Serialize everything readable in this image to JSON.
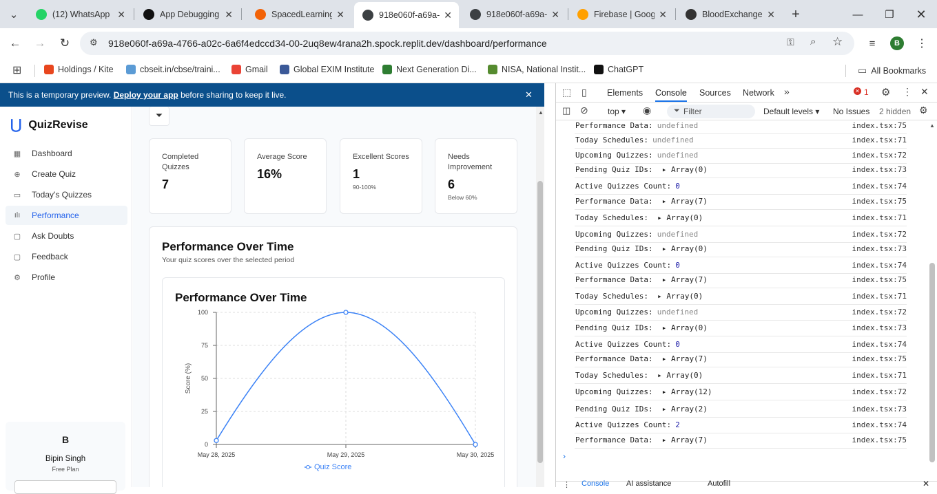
{
  "browser": {
    "tabs": [
      {
        "title": "(12) WhatsApp",
        "color": "#25d366"
      },
      {
        "title": "App Debugging",
        "color": "#111111"
      },
      {
        "title": "SpacedLearning",
        "color": "#f26207"
      },
      {
        "title": "918e060f-a69a-",
        "color": "#3c4043"
      },
      {
        "title": "918e060f-a69a-",
        "color": "#3c4043"
      },
      {
        "title": "Firebase | Googl",
        "color": "#ffa000"
      },
      {
        "title": "BloodExchanger",
        "color": "#333333"
      }
    ],
    "url": "918e060f-a69a-4766-a02c-6a6f4edccd34-00-2uq8ew4rana2h.spock.replit.dev/dashboard/performance",
    "profile_initial": "B",
    "bookmarks": [
      {
        "label": "Holdings / Kite",
        "color": "#e8461e"
      },
      {
        "label": "cbseit.in/cbse/traini...",
        "color": "#5b9bd5"
      },
      {
        "label": "Gmail",
        "color": "#ea4335"
      },
      {
        "label": "Global EXIM Institute",
        "color": "#3b5998"
      },
      {
        "label": "Next Generation Di...",
        "color": "#2e7d32"
      },
      {
        "label": "NISA, National Instit...",
        "color": "#558b2f"
      },
      {
        "label": "ChatGPT",
        "color": "#111111"
      }
    ],
    "all_bookmarks": "All Bookmarks"
  },
  "banner": {
    "prefix": "This is a temporary preview. ",
    "link": "Deploy your app",
    "suffix": " before sharing to keep it live."
  },
  "app": {
    "name": "QuizRevise",
    "nav": [
      {
        "label": "Dashboard",
        "icon": "▦"
      },
      {
        "label": "Create Quiz",
        "icon": "⊕"
      },
      {
        "label": "Today's Quizzes",
        "icon": "▭"
      },
      {
        "label": "Performance",
        "icon": "ılı"
      },
      {
        "label": "Ask Doubts",
        "icon": "▢"
      },
      {
        "label": "Feedback",
        "icon": "▢"
      },
      {
        "label": "Profile",
        "icon": "⚙"
      }
    ],
    "user": {
      "initial": "B",
      "name": "Bipin Singh",
      "plan": "Free Plan"
    }
  },
  "stats": [
    {
      "label": "Completed Quizzes",
      "value": "7",
      "sub": ""
    },
    {
      "label": "Average Score",
      "value": "16%",
      "sub": ""
    },
    {
      "label": "Excellent Scores",
      "value": "1",
      "sub": "90-100%"
    },
    {
      "label": "Needs Improvement",
      "value": "6",
      "sub": "Below 60%"
    }
  ],
  "performance": {
    "title": "Performance Over Time",
    "subtitle": "Your quiz scores over the selected period"
  },
  "chart_data": {
    "type": "line",
    "title": "Performance Over Time",
    "ylabel": "Score (%)",
    "xlabel": "",
    "x": [
      "May 28, 2025",
      "May 29, 2025",
      "May 30, 2025"
    ],
    "series": [
      {
        "name": "Quiz Score",
        "values": [
          3,
          100,
          0
        ],
        "color": "#3b82f6"
      }
    ],
    "ylim": [
      0,
      100
    ],
    "yticks": [
      0,
      25,
      50,
      75,
      100
    ],
    "grid": true,
    "legend": "bottom"
  },
  "devtools": {
    "tabs": [
      "Elements",
      "Console",
      "Sources",
      "Network"
    ],
    "error_count": "1",
    "context": "top",
    "filter_placeholder": "Filter",
    "levels": "Default levels",
    "issues": "No Issues",
    "hidden": "2 hidden",
    "logs": [
      {
        "key": "Performance Data:",
        "value": "undefined",
        "kind": "und",
        "src": "index.tsx:75"
      },
      {
        "key": "Today Schedules:",
        "value": "undefined",
        "kind": "und",
        "src": "index.tsx:71"
      },
      {
        "key": "Upcoming Quizzes:",
        "value": "undefined",
        "kind": "und",
        "src": "index.tsx:72"
      },
      {
        "key": "Pending Quiz IDs:",
        "value": "▸ Array(0)",
        "kind": "arr",
        "src": "index.tsx:73"
      },
      {
        "key": "Active Quizzes Count:",
        "value": "0",
        "kind": "num",
        "src": "index.tsx:74"
      },
      {
        "key": "Performance Data:",
        "value": "▸ Array(7)",
        "kind": "arr",
        "src": "index.tsx:75"
      },
      {
        "key": "Today Schedules:",
        "value": "▸ Array(0)",
        "kind": "arr",
        "src": "index.tsx:71"
      },
      {
        "key": "Upcoming Quizzes:",
        "value": "undefined",
        "kind": "und",
        "src": "index.tsx:72"
      },
      {
        "key": "Pending Quiz IDs:",
        "value": "▸ Array(0)",
        "kind": "arr",
        "src": "index.tsx:73"
      },
      {
        "key": "Active Quizzes Count:",
        "value": "0",
        "kind": "num",
        "src": "index.tsx:74"
      },
      {
        "key": "Performance Data:",
        "value": "▸ Array(7)",
        "kind": "arr",
        "src": "index.tsx:75"
      },
      {
        "key": "Today Schedules:",
        "value": "▸ Array(0)",
        "kind": "arr",
        "src": "index.tsx:71"
      },
      {
        "key": "Upcoming Quizzes:",
        "value": "undefined",
        "kind": "und",
        "src": "index.tsx:72"
      },
      {
        "key": "Pending Quiz IDs:",
        "value": "▸ Array(0)",
        "kind": "arr",
        "src": "index.tsx:73"
      },
      {
        "key": "Active Quizzes Count:",
        "value": "0",
        "kind": "num",
        "src": "index.tsx:74"
      },
      {
        "key": "Performance Data:",
        "value": "▸ Array(7)",
        "kind": "arr",
        "src": "index.tsx:75"
      },
      {
        "key": "Today Schedules:",
        "value": "▸ Array(0)",
        "kind": "arr",
        "src": "index.tsx:71"
      },
      {
        "key": "Upcoming Quizzes:",
        "value": "▸ Array(12)",
        "kind": "arr",
        "src": "index.tsx:72"
      },
      {
        "key": "Pending Quiz IDs:",
        "value": "▸ Array(2)",
        "kind": "arr",
        "src": "index.tsx:73"
      },
      {
        "key": "Active Quizzes Count:",
        "value": "2",
        "kind": "num",
        "src": "index.tsx:74"
      },
      {
        "key": "Performance Data:",
        "value": "▸ Array(7)",
        "kind": "arr",
        "src": "index.tsx:75"
      }
    ],
    "drawer_tabs": [
      "Console",
      "AI assistance",
      "Autofill"
    ]
  }
}
